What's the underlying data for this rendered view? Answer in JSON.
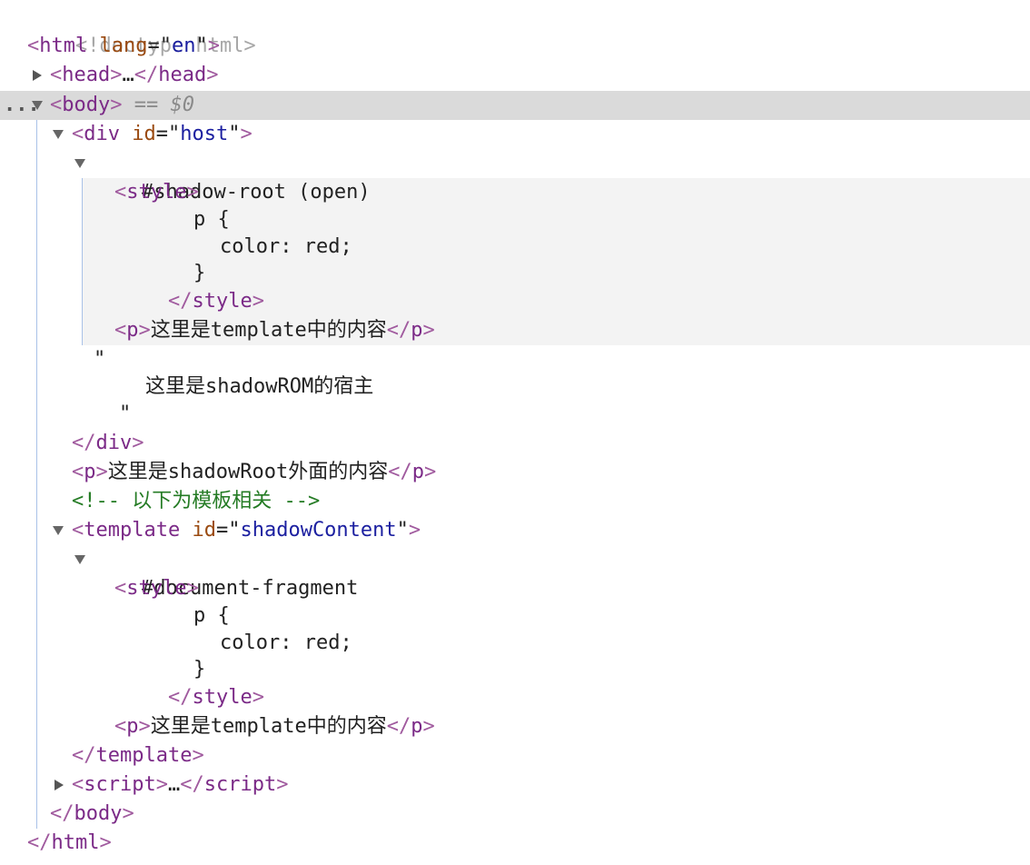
{
  "tree": {
    "doctype": "<!doctype html>",
    "html_tag": "html",
    "lang_attr": "lang",
    "lang_value": "en",
    "head_tag": "head",
    "ellipsis": "…",
    "body_tag": "body",
    "selected_marker": "== ",
    "selected_var": "$0",
    "dots": "...",
    "div_tag": "div",
    "id_attr": "id",
    "host_value": "host",
    "shadow_root_label": "#shadow-root (open)",
    "style_tag": "style",
    "css_selector": "p {",
    "css_declaration": "color: red;",
    "css_close": "}",
    "p_tag": "p",
    "template_text": "这里是template中的内容",
    "quote": "\"",
    "host_text": "这里是shadowROM的宿主",
    "outside_text": "这里是shadowRoot外面的内容",
    "comment": "<!-- 以下为模板相关 -->",
    "template_tag": "template",
    "template_id_value": "shadowContent",
    "fragment_label": "#document-fragment",
    "script_tag": "script"
  }
}
